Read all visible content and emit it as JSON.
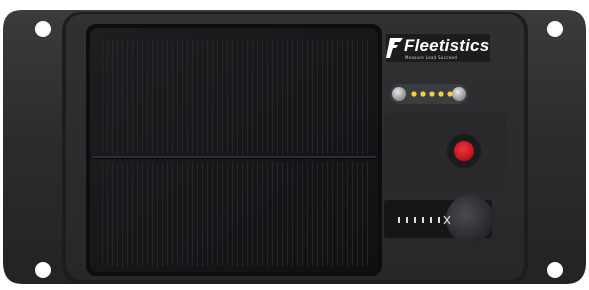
{
  "brand": {
    "name": "Fleetistics",
    "tagline": "Measure Lead Succeed",
    "logo_icon": "f-arrow-logo-icon"
  },
  "device": {
    "type": "solar-powered GPS tracker",
    "housing_color": "#2b2c2e",
    "panel_color": "#141516"
  },
  "indicators": {
    "led_count": 5,
    "led_color": "#f2d23c",
    "button_color": "#d8202a"
  }
}
